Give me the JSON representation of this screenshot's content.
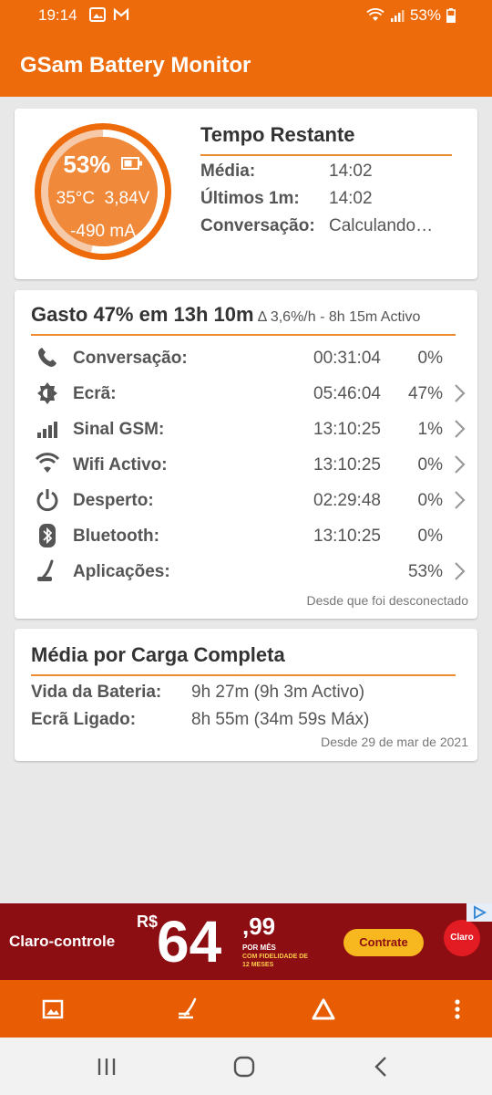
{
  "status_bar": {
    "time": "19:14",
    "left_icons": [
      "image-icon",
      "gmail-icon"
    ],
    "battery_text": "53%",
    "right_icons": [
      "wifi-icon",
      "signal-icon",
      "battery-icon"
    ]
  },
  "app_bar": {
    "title": "GSam Battery Monitor"
  },
  "battery_card": {
    "gauge": {
      "percent_label": "53%",
      "level": 0.53,
      "temp_voltage": "35°C  3,84V",
      "current": "-490 mA"
    },
    "title": "Tempo Restante",
    "rows": [
      {
        "label": "Média:",
        "value": "14:02"
      },
      {
        "label": "Últimos 1m:",
        "value": "14:02"
      },
      {
        "label": "Conversação:",
        "value": "Calculando…"
      }
    ]
  },
  "usage_card": {
    "title": "Gasto 47% em 13h 10m",
    "subtitle": "Δ 3,6%/h - 8h 15m Activo",
    "rows": [
      {
        "icon": "phone-icon",
        "label": "Conversação:",
        "time": "00:31:04",
        "percent": "0%",
        "chevron": false
      },
      {
        "icon": "screen-brightness-icon",
        "label": "Ecrã:",
        "time": "05:46:04",
        "percent": "47%",
        "chevron": true
      },
      {
        "icon": "signal-bars-icon",
        "label": "Sinal GSM:",
        "time": "13:10:25",
        "percent": "1%",
        "chevron": true
      },
      {
        "icon": "wifi-icon",
        "label": "Wifi Activo:",
        "time": "13:10:25",
        "percent": "0%",
        "chevron": true
      },
      {
        "icon": "power-icon",
        "label": "Desperto:",
        "time": "02:29:48",
        "percent": "0%",
        "chevron": true
      },
      {
        "icon": "bluetooth-icon",
        "label": "Bluetooth:",
        "time": "13:10:25",
        "percent": "0%",
        "chevron": false
      },
      {
        "icon": "apps-icon",
        "label": "Aplicações:",
        "time": "",
        "percent": "53%",
        "chevron": true
      }
    ],
    "footer": "Desde que foi desconectado"
  },
  "full_charge_card": {
    "title": "Média por Carga Completa",
    "rows": [
      {
        "label": "Vida da Bateria:",
        "value": "9h 27m (9h 3m Activo)"
      },
      {
        "label": "Ecrã Ligado:",
        "value": "8h 55m (34m 59s Máx)"
      }
    ],
    "footer": "Desde 29 de mar de 2021"
  },
  "ad": {
    "brand": "Claro-controle",
    "currency": "R$",
    "price_main": "64",
    "price_cents": ",99",
    "fine_print_1": "POR MÊS",
    "fine_print_2": "COM FIDELIDADE DE 12 MESES",
    "cta": "Contrate",
    "logo_text": "Claro"
  },
  "bottom_bar": {
    "icons": [
      "image-icon",
      "apps-icon",
      "delta-icon",
      "more-vert-icon"
    ]
  },
  "nav_bar": {
    "icons": [
      "recents-icon",
      "home-icon",
      "back-icon"
    ]
  },
  "colors": {
    "accent": "#ee6b0b",
    "divider": "#ee8a30",
    "bottom_bar": "#e85d04",
    "ad_bg": "#8c0d12"
  }
}
